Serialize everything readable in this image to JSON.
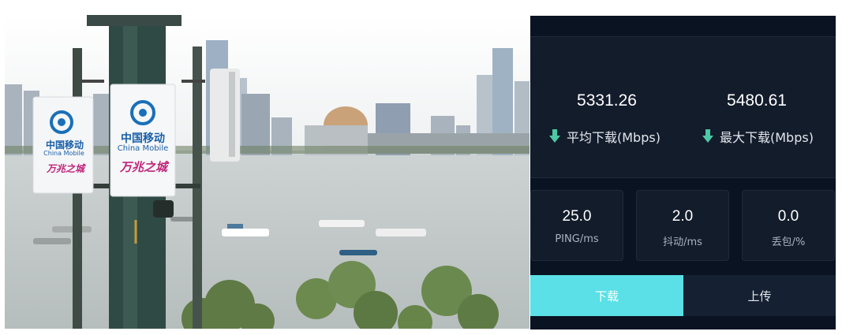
{
  "photo": {
    "brand_cn": "中国移动",
    "brand_en": "China Mobile",
    "slogan": "万兆之城"
  },
  "speedtest": {
    "avg_download_value": "5331.26",
    "avg_download_label": "平均下载(Mbps)",
    "max_download_value": "5480.61",
    "max_download_label": "最大下载(Mbps)",
    "metrics": [
      {
        "value": "25.0",
        "label": "PING/ms"
      },
      {
        "value": "2.0",
        "label": "抖动/ms"
      },
      {
        "value": "0.0",
        "label": "丢包/%"
      }
    ],
    "tabs": {
      "download": "下载",
      "upload": "上传"
    }
  },
  "colors": {
    "panel_bg": "#0a1322",
    "card_bg": "#131c2b",
    "accent": "#5ae0e6",
    "arrow": "#4cc9a4"
  }
}
